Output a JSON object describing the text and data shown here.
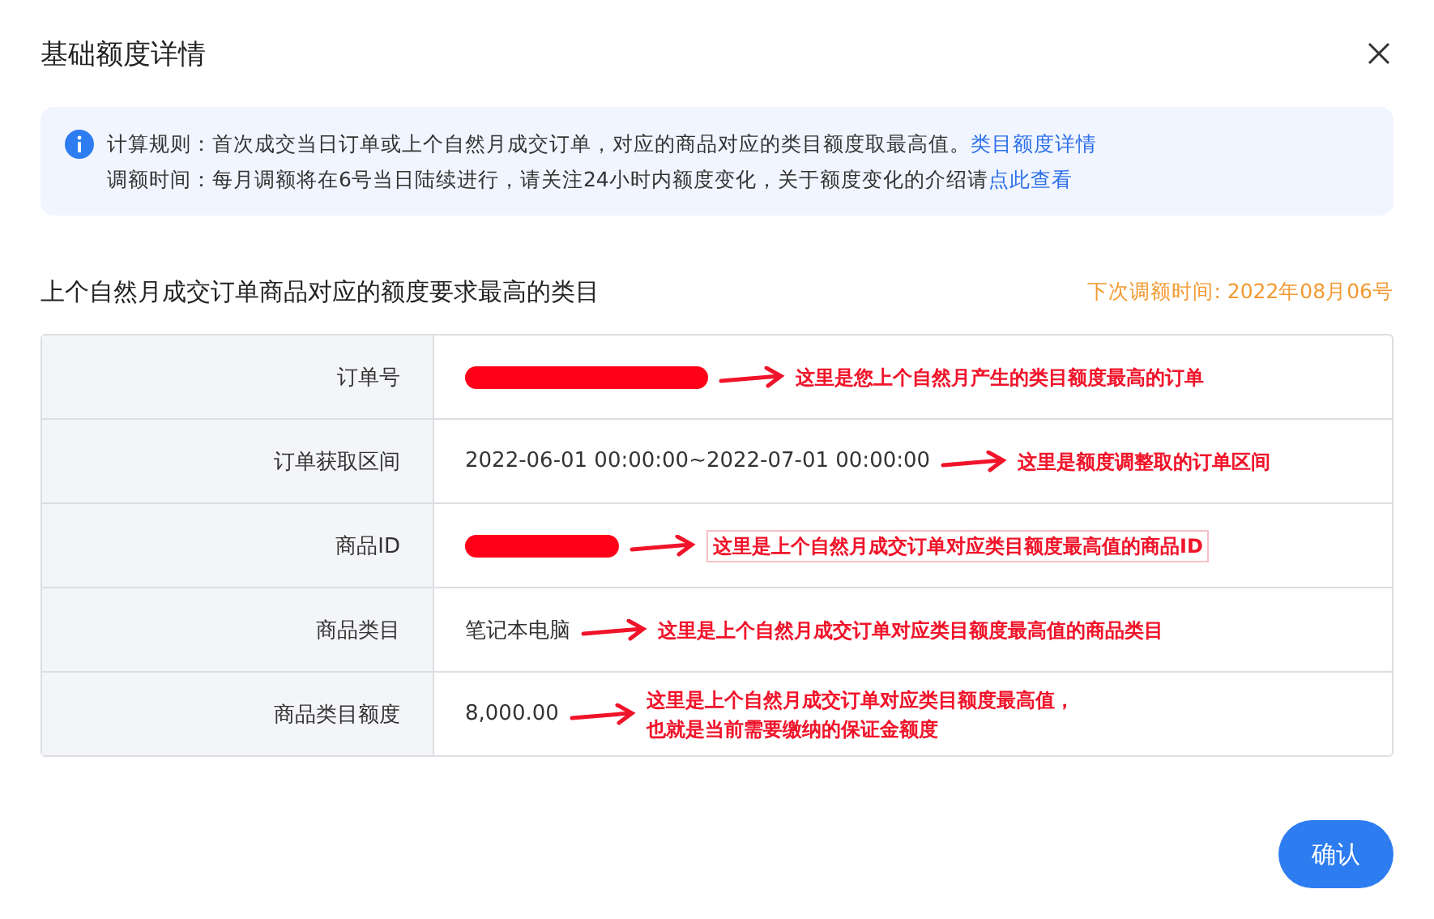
{
  "dialog": {
    "title": "基础额度详情"
  },
  "notice": {
    "lines": [
      {
        "label": "计算规则：",
        "text": "首次成交当日订单或上个自然月成交订单，对应的商品对应的类目额度取最高值。",
        "link": "类目额度详情"
      },
      {
        "label": "调额时间：",
        "text": "每月调额将在6号当日陆续进行，请关注24小时内额度变化，关于额度变化的介绍请",
        "link": "点此查看"
      }
    ]
  },
  "section": {
    "title": "上个自然月成交订单商品对应的额度要求最高的类目",
    "next_adjust": "下次调额时间: 2022年08月06号"
  },
  "rows": [
    {
      "label": "订单号",
      "kind": "redacted",
      "note": [
        "这里是您上个自然月产生的类目额度最高的订单"
      ],
      "boxed": false
    },
    {
      "label": "订单获取区间",
      "kind": "text",
      "value": "2022-06-01 00:00:00~2022-07-01 00:00:00",
      "note": [
        "这里是额度调整取的订单区间"
      ],
      "boxed": false
    },
    {
      "label": "商品ID",
      "kind": "redacted",
      "note": [
        "这里是上个自然月成交订单对应类目额度最高值的商品ID"
      ],
      "boxed": true
    },
    {
      "label": "商品类目",
      "kind": "text",
      "value": "笔记本电脑",
      "note": [
        "这里是上个自然月成交订单对应类目额度最高值的商品类目"
      ],
      "boxed": false
    },
    {
      "label": "商品类目额度",
      "kind": "text",
      "value": "8,000.00",
      "note": [
        "这里是上个自然月成交订单对应类目额度最高值，",
        "也就是当前需要缴纳的保证金额度"
      ],
      "boxed": false
    }
  ],
  "confirm": "确认"
}
